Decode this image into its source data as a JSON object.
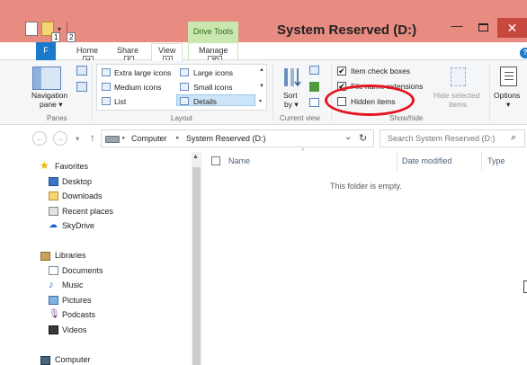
{
  "window": {
    "title": "System Reserved (D:)",
    "context_tab": "Drive Tools",
    "minimize_glyph": "—",
    "close_glyph": "✕"
  },
  "qat": {
    "keytip_1": "1",
    "keytip_2": "2",
    "chevron": "▾"
  },
  "tabs": {
    "file": "F",
    "home": "Home",
    "share": "Share",
    "view": "View",
    "manage": "Manage",
    "keytip_home": "H",
    "keytip_share": "S",
    "keytip_view": "V",
    "keytip_manage": "JD"
  },
  "ribbon": {
    "panes": {
      "navigation_pane_line1": "Navigation",
      "navigation_pane_line2": "pane ▾",
      "group_label": "Panes"
    },
    "layout": {
      "items": [
        "Extra large icons",
        "Large icons",
        "Medium icons",
        "Small icons",
        "List",
        "Details"
      ],
      "selected": "Details",
      "group_label": "Layout"
    },
    "current_view": {
      "sort_by_line1": "Sort",
      "sort_by_line2": "by ▾",
      "group_label": "Current view"
    },
    "show_hide": {
      "item_check_boxes": "Item check boxes",
      "item_check_boxes_checked": true,
      "file_name_extensions": "File name extensions",
      "file_name_extensions_checked": true,
      "hidden_items": "Hidden items",
      "hidden_items_checked": false,
      "hide_selected_items_line1": "Hide selected",
      "hide_selected_items_line2": "items",
      "group_label": "Show/hide",
      "check_glyph": "✔"
    },
    "options": {
      "label": "Options",
      "chevron": "▾"
    },
    "help_glyph": "?"
  },
  "address": {
    "back_glyph": "←",
    "forward_glyph": "→",
    "recent_glyph": "▾",
    "up_glyph": "↑",
    "crumbs": [
      "Computer",
      "System Reserved (D:)"
    ],
    "separator": "▸",
    "dropdown_glyph": "⌄",
    "refresh_glyph": "↻",
    "search_placeholder": "Search System Reserved (D:)",
    "search_glyph": "⌕"
  },
  "nav": {
    "favorites": "Favorites",
    "favorites_items": [
      "Desktop",
      "Downloads",
      "Recent places",
      "SkyDrive"
    ],
    "libraries": "Libraries",
    "libraries_items": [
      "Documents",
      "Music",
      "Pictures",
      "Podcasts",
      "Videos"
    ],
    "computer": "Computer",
    "scroll_up_glyph": "▲"
  },
  "content": {
    "columns": [
      "Name",
      "Date modified",
      "Type"
    ],
    "sort_indicator": "^",
    "empty_message": "This folder is empty."
  }
}
